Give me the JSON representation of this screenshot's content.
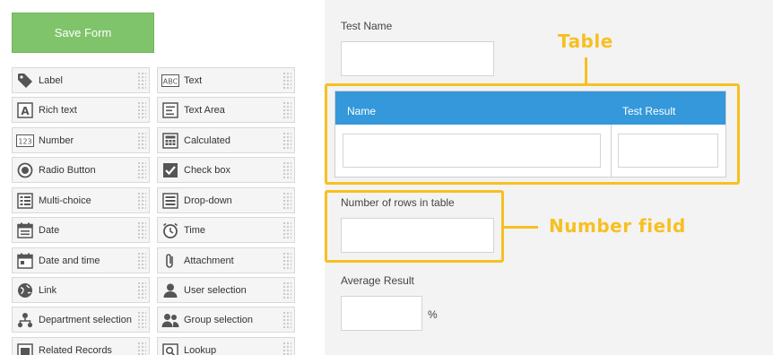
{
  "toolbar": {
    "save_label": "Save Form"
  },
  "palette": {
    "left": [
      {
        "label": "Label",
        "icon": "tag-icon"
      },
      {
        "label": "Rich text",
        "icon": "rich-text-icon"
      },
      {
        "label": "Number",
        "icon": "number-icon"
      },
      {
        "label": "Radio Button",
        "icon": "radio-icon"
      },
      {
        "label": "Multi-choice",
        "icon": "multi-choice-icon"
      },
      {
        "label": "Date",
        "icon": "calendar-icon"
      },
      {
        "label": "Date and time",
        "icon": "calendar-time-icon"
      },
      {
        "label": "Link",
        "icon": "globe-icon"
      },
      {
        "label": "Department selection",
        "icon": "org-chart-icon"
      },
      {
        "label": "Related Records",
        "icon": "related-records-icon"
      }
    ],
    "right": [
      {
        "label": "Text",
        "icon": "text-abc-icon"
      },
      {
        "label": "Text Area",
        "icon": "text-area-icon"
      },
      {
        "label": "Calculated",
        "icon": "calculator-icon"
      },
      {
        "label": "Check box",
        "icon": "checkbox-icon"
      },
      {
        "label": "Drop-down",
        "icon": "dropdown-icon"
      },
      {
        "label": "Time",
        "icon": "clock-icon"
      },
      {
        "label": "Attachment",
        "icon": "paperclip-icon"
      },
      {
        "label": "User selection",
        "icon": "user-icon"
      },
      {
        "label": "Group selection",
        "icon": "group-icon"
      },
      {
        "label": "Lookup",
        "icon": "lookup-icon"
      }
    ]
  },
  "form": {
    "test_name_label": "Test Name",
    "table": {
      "col1": "Name",
      "col2": "Test Result"
    },
    "rows_label": "Number of rows in table",
    "average_label": "Average Result",
    "average_unit": "%"
  },
  "annotations": {
    "table": "Table",
    "number_field": "Number field"
  },
  "colors": {
    "save_button": "#7fc46b",
    "table_header": "#3498db",
    "highlight": "#f7c021"
  }
}
